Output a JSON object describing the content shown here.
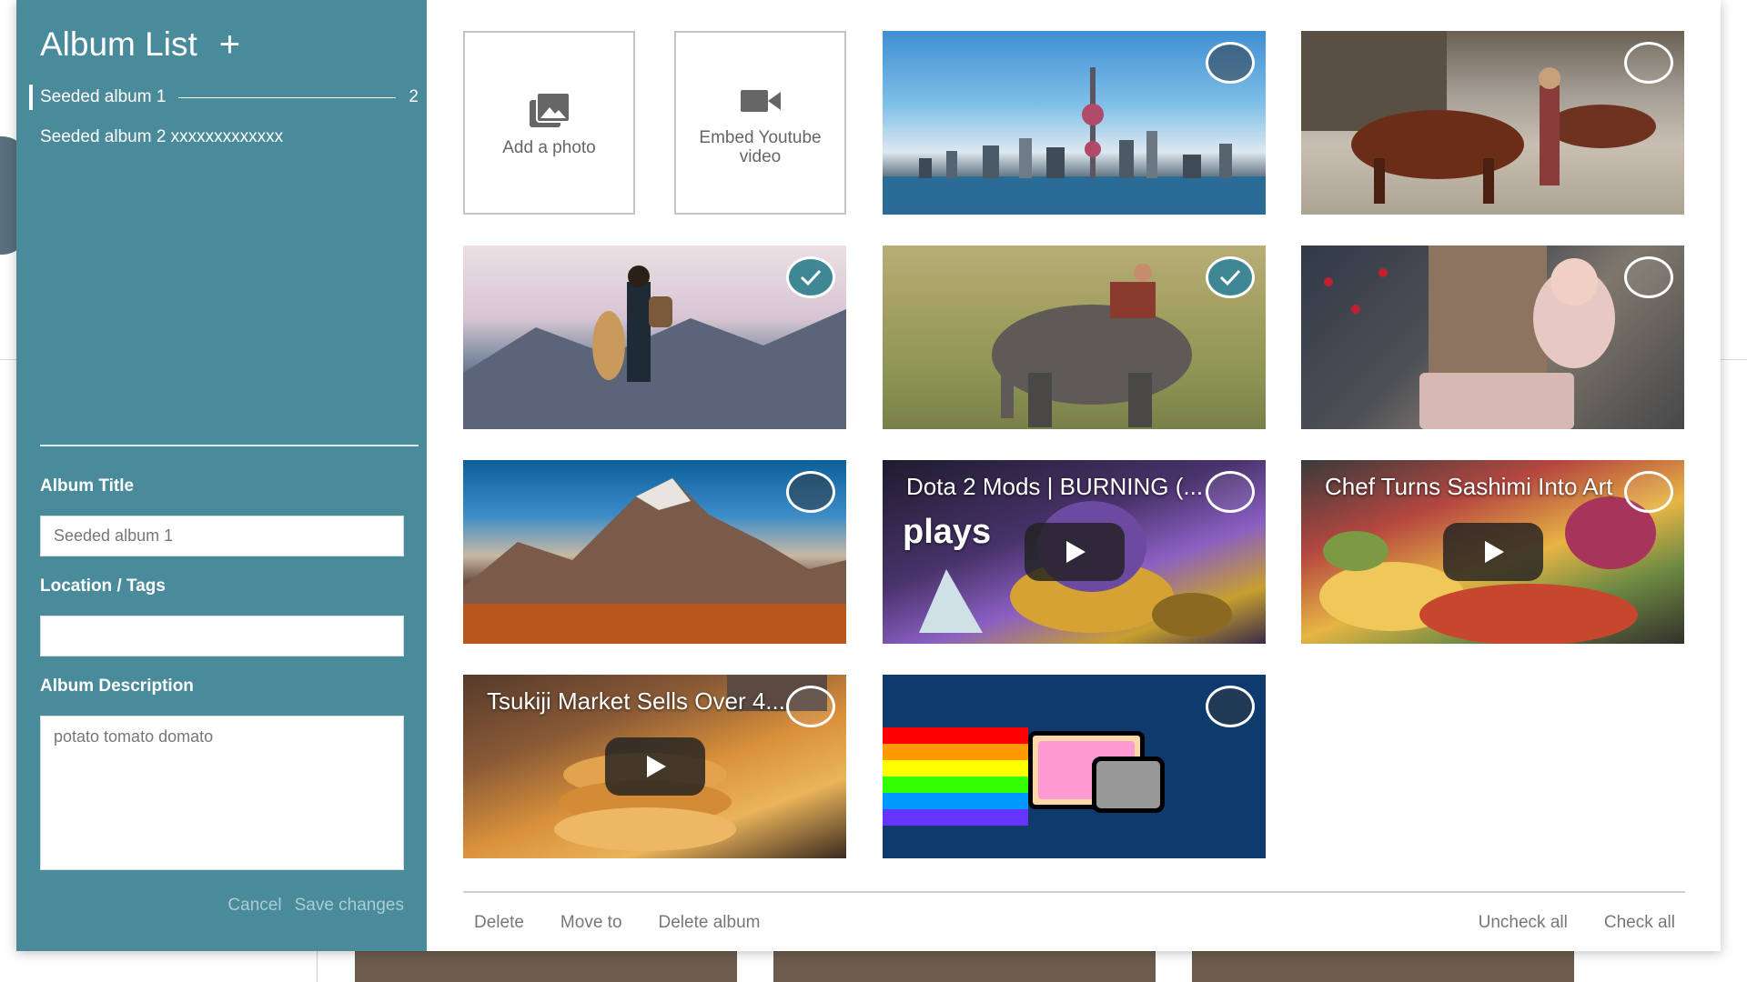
{
  "sidebar": {
    "title": "Album List",
    "add_symbol": "+",
    "albums": [
      {
        "name": "Seeded album 1",
        "count": "2"
      },
      {
        "name": "Seeded album 2 xxxxxxxxxxxxx",
        "count": ""
      }
    ],
    "fields": {
      "album_title_label": "Album Title",
      "album_title_value": "Seeded album 1",
      "location_label": "Location / Tags",
      "location_value": "",
      "description_label": "Album Description",
      "description_value": "potato tomato domato"
    },
    "cancel_label": "Cancel",
    "save_label": "Save changes"
  },
  "tiles": {
    "add_photo_label": "Add a photo",
    "embed_video_label": "Embed Youtube video",
    "videos": [
      {
        "title": "Dota 2 Mods | BURNING (...",
        "subtitle": "plays"
      },
      {
        "title": "Chef Turns Sashimi Into Art"
      },
      {
        "title": "Tsukiji Market Sells Over 4..."
      }
    ]
  },
  "footer": {
    "delete_label": "Delete",
    "move_label": "Move to",
    "delete_album_label": "Delete album",
    "uncheck_all_label": "Uncheck all",
    "check_all_label": "Check all"
  },
  "colors": {
    "sidebar_bg": "#4a8b9b",
    "check_on": "#3f8794"
  }
}
